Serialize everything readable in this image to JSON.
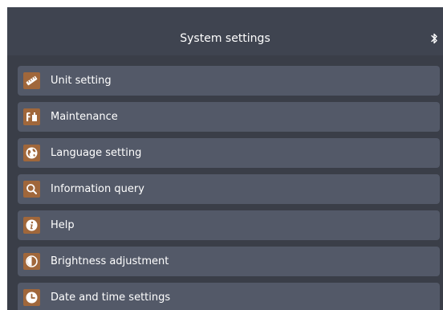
{
  "header": {
    "title": "System settings",
    "status_icon": "bluetooth-icon"
  },
  "menu": {
    "items": [
      {
        "label": "Unit setting",
        "icon": "ruler-icon"
      },
      {
        "label": "Maintenance",
        "icon": "maintenance-icon"
      },
      {
        "label": "Language setting",
        "icon": "globe-icon"
      },
      {
        "label": "Information query",
        "icon": "search-icon"
      },
      {
        "label": "Help",
        "icon": "info-icon"
      },
      {
        "label": "Brightness adjustment",
        "icon": "brightness-icon"
      },
      {
        "label": "Date and time settings",
        "icon": "clock-icon"
      }
    ]
  },
  "colors": {
    "background": "#3a3e48",
    "header": "#3f4450",
    "item": "#535968",
    "icon_accent": "#a0673b",
    "text": "#ffffff"
  }
}
